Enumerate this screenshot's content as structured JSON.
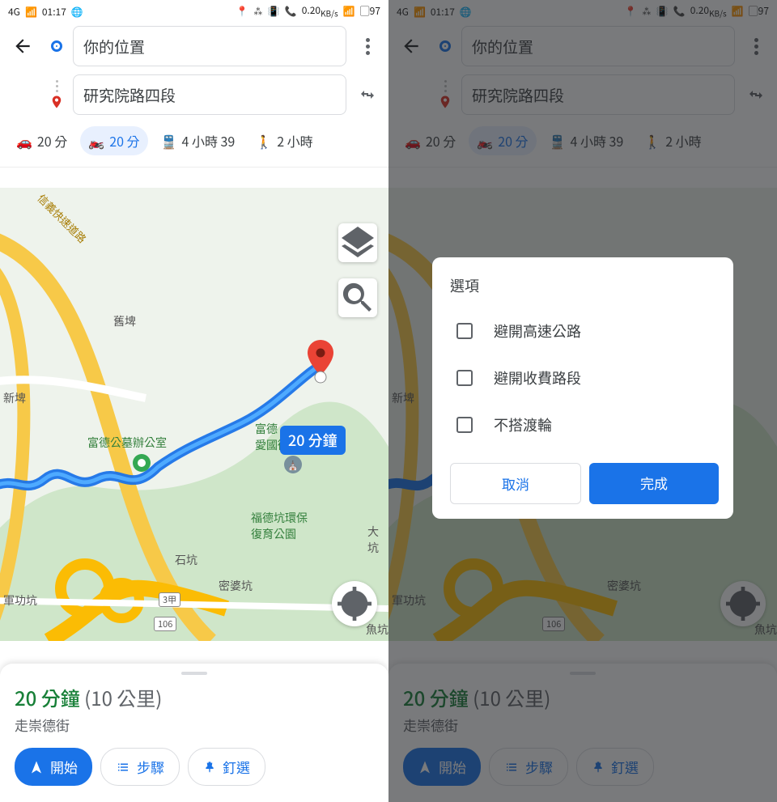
{
  "status": {
    "time": "01:17",
    "net_label": "4G",
    "speed": "0.20",
    "speed_unit": "KB/s",
    "battery": "97"
  },
  "search": {
    "origin": "你的位置",
    "dest": "研究院路四段"
  },
  "modes": {
    "car": {
      "label": "20 分"
    },
    "moto": {
      "label": "20 分"
    },
    "transit": {
      "label": "4 小時 39"
    },
    "walk": {
      "label": "2 小時"
    }
  },
  "map": {
    "route_duration_label": "20 分鐘",
    "labels": {
      "cemetery": "富德公墓辦公室",
      "fude": "富德\n愛國衛",
      "eco_park": "福德坑環保\n復育公園",
      "jiupi": "舊埤",
      "xinpi": "新埤",
      "shikeng": "石坑",
      "mipokeng": "密婆坑",
      "dakeng": "大坑",
      "jungongkeng": "軍功坑",
      "yukeng": "魚坑",
      "road_label_a": "信義快速道路",
      "hwy3": "3甲",
      "hwy106": "106"
    }
  },
  "sheet": {
    "duration": "20 分鐘",
    "distance": "(10 公里)",
    "via": "走崇德街",
    "start": "開始",
    "steps": "步驟",
    "pin": "釘選"
  },
  "options_dialog": {
    "title": "選項",
    "items": [
      "避開高速公路",
      "避開收費路段",
      "不搭渡輪"
    ],
    "cancel": "取消",
    "done": "完成"
  }
}
